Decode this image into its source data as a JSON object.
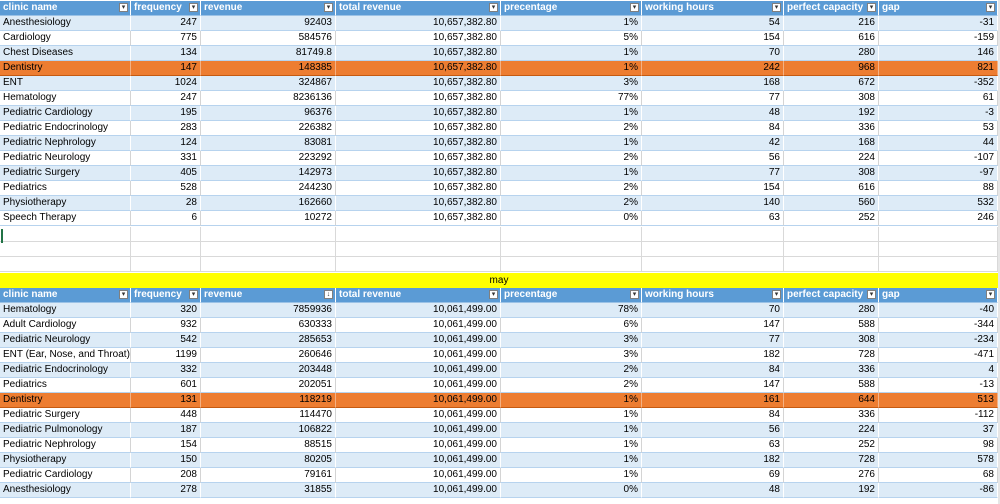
{
  "headers": [
    "clinic name",
    "frequency",
    "revenue",
    "total revenue",
    "precentage",
    "working hours",
    "perfect capacity",
    "gap"
  ],
  "table1": {
    "rows": [
      [
        "Anesthesiology",
        "247",
        "92403",
        "10,657,382.80",
        "1%",
        "54",
        "216",
        "-31"
      ],
      [
        "Cardiology",
        "775",
        "584576",
        "10,657,382.80",
        "5%",
        "154",
        "616",
        "-159"
      ],
      [
        "Chest Diseases",
        "134",
        "81749.8",
        "10,657,382.80",
        "1%",
        "70",
        "280",
        "146"
      ],
      [
        "Dentistry",
        "147",
        "148385",
        "10,657,382.80",
        "1%",
        "242",
        "968",
        "821"
      ],
      [
        "ENT",
        "1024",
        "324867",
        "10,657,382.80",
        "3%",
        "168",
        "672",
        "-352"
      ],
      [
        "Hematology",
        "247",
        "8236136",
        "10,657,382.80",
        "77%",
        "77",
        "308",
        "61"
      ],
      [
        "Pediatric Cardiology",
        "195",
        "96376",
        "10,657,382.80",
        "1%",
        "48",
        "192",
        "-3"
      ],
      [
        "Pediatric Endocrinology",
        "283",
        "226382",
        "10,657,382.80",
        "2%",
        "84",
        "336",
        "53"
      ],
      [
        "Pediatric Nephrology",
        "124",
        "83081",
        "10,657,382.80",
        "1%",
        "42",
        "168",
        "44"
      ],
      [
        "Pediatric Neurology",
        "331",
        "223292",
        "10,657,382.80",
        "2%",
        "56",
        "224",
        "-107"
      ],
      [
        "Pediatric Surgery",
        "405",
        "142973",
        "10,657,382.80",
        "1%",
        "77",
        "308",
        "-97"
      ],
      [
        "Pediatrics",
        "528",
        "244230",
        "10,657,382.80",
        "2%",
        "154",
        "616",
        "88"
      ],
      [
        "Physiotherapy",
        "28",
        "162660",
        "10,657,382.80",
        "2%",
        "140",
        "560",
        "532"
      ],
      [
        "Speech Therapy",
        "6",
        "10272",
        "10,657,382.80",
        "0%",
        "63",
        "252",
        "246"
      ]
    ]
  },
  "month_label": "may",
  "table2": {
    "rows": [
      [
        "Hematology",
        "320",
        "7859936",
        "10,061,499.00",
        "78%",
        "70",
        "280",
        "-40"
      ],
      [
        "Adult Cardiology",
        "932",
        "630333",
        "10,061,499.00",
        "6%",
        "147",
        "588",
        "-344"
      ],
      [
        "Pediatric Neurology",
        "542",
        "285653",
        "10,061,499.00",
        "3%",
        "77",
        "308",
        "-234"
      ],
      [
        "ENT (Ear, Nose, and Throat)",
        "1199",
        "260646",
        "10,061,499.00",
        "3%",
        "182",
        "728",
        "-471"
      ],
      [
        "Pediatric Endocrinology",
        "332",
        "203448",
        "10,061,499.00",
        "2%",
        "84",
        "336",
        "4"
      ],
      [
        "Pediatrics",
        "601",
        "202051",
        "10,061,499.00",
        "2%",
        "147",
        "588",
        "-13"
      ],
      [
        "Dentistry",
        "131",
        "118219",
        "10,061,499.00",
        "1%",
        "161",
        "644",
        "513"
      ],
      [
        "Pediatric Surgery",
        "448",
        "114470",
        "10,061,499.00",
        "1%",
        "84",
        "336",
        "-112"
      ],
      [
        "Pediatric Pulmonology",
        "187",
        "106822",
        "10,061,499.00",
        "1%",
        "56",
        "224",
        "37"
      ],
      [
        "Pediatric Nephrology",
        "154",
        "88515",
        "10,061,499.00",
        "1%",
        "63",
        "252",
        "98"
      ],
      [
        "Physiotherapy",
        "150",
        "80205",
        "10,061,499.00",
        "1%",
        "182",
        "728",
        "578"
      ],
      [
        "Pediatric Cardiology",
        "208",
        "79161",
        "10,061,499.00",
        "1%",
        "69",
        "276",
        "68"
      ],
      [
        "Anesthesiology",
        "278",
        "31855",
        "10,061,499.00",
        "0%",
        "48",
        "192",
        "-86"
      ]
    ]
  },
  "highlight_clinic": "Dentistry",
  "colors": {
    "header": "#5b9bd5",
    "band": "#ddebf7",
    "highlight": "#ed7d31",
    "month_band": "#ffff00"
  },
  "filter_icons": {
    "filter": "dropdown-arrow-icon",
    "sorted": "sort-filter-icon"
  }
}
